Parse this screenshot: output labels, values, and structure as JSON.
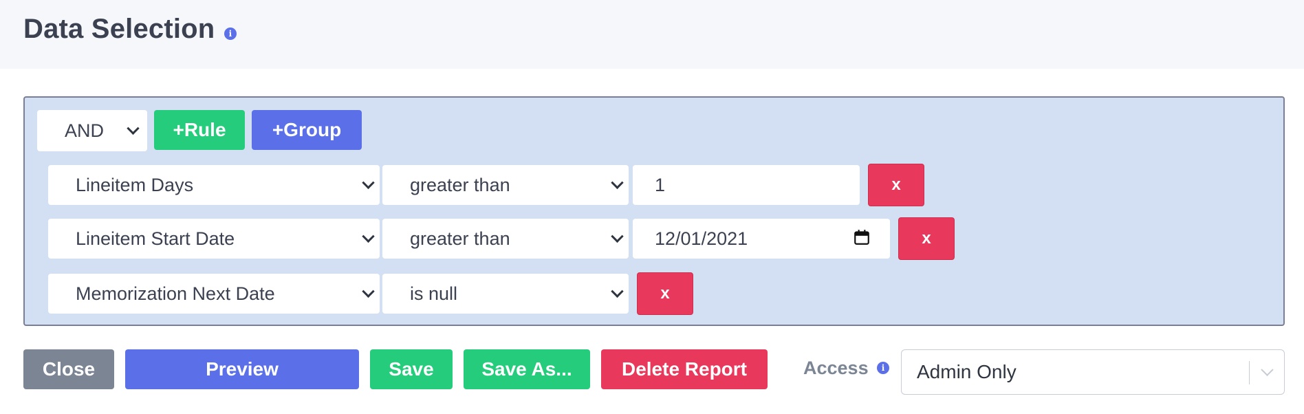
{
  "page": {
    "title": "Data Selection",
    "info_icon": "i"
  },
  "query": {
    "conjunction": "AND",
    "add_rule_label": "+Rule",
    "add_group_label": "+Group",
    "rules": [
      {
        "field": "Lineitem Days",
        "operator": "greater than",
        "value": "1",
        "remove_label": "x"
      },
      {
        "field": "Lineitem Start Date",
        "operator": "greater than",
        "value": "12/01/2021",
        "remove_label": "x"
      },
      {
        "field": "Memorization Next Date",
        "operator": "is null",
        "remove_label": "x"
      }
    ]
  },
  "actions": {
    "close_label": "Close",
    "preview_label": "Preview",
    "save_label": "Save",
    "save_as_label": "Save As...",
    "delete_label": "Delete Report"
  },
  "access": {
    "label": "Access",
    "info_icon": "i",
    "selected": "Admin Only"
  },
  "colors": {
    "green": "#25cc7b",
    "blue": "#5a6fe8",
    "red": "#e8395c",
    "gray": "#7b8594",
    "query_bg": "#d3e0f4"
  }
}
